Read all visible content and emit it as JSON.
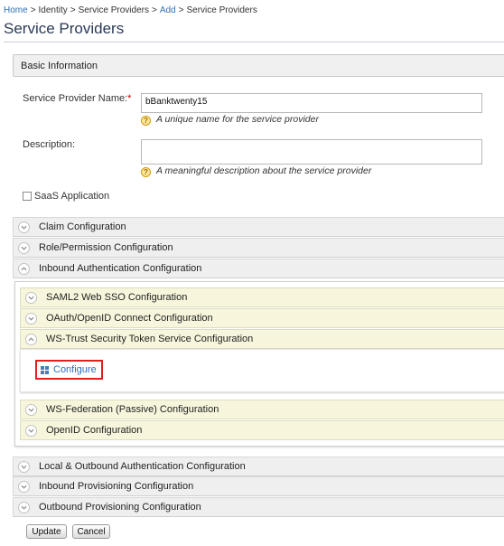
{
  "breadcrumb": {
    "home": "Home",
    "identity": "Identity",
    "service_providers": "Service Providers",
    "add": "Add",
    "current": "Service Providers",
    "separator": ">"
  },
  "page_title": "Service Providers",
  "basic_info": {
    "header": "Basic Information",
    "name_label": "Service Provider Name:",
    "required_mark": "*",
    "name_value": "bBanktwenty15",
    "name_hint": "A unique name for the service provider",
    "description_label": "Description:",
    "description_value": "",
    "description_hint": "A meaningful description about the service provider",
    "saas_label": "SaaS Application",
    "saas_checked": false
  },
  "sections": {
    "claim": "Claim Configuration",
    "role": "Role/Permission Configuration",
    "inbound_auth": "Inbound Authentication Configuration",
    "local_outbound": "Local & Outbound Authentication Configuration",
    "inbound_prov": "Inbound Provisioning Configuration",
    "outbound_prov": "Outbound Provisioning Configuration"
  },
  "inbound_auth_sections": {
    "saml2": "SAML2 Web SSO Configuration",
    "oauth": "OAuth/OpenID Connect Configuration",
    "ws_trust": "WS-Trust Security Token Service Configuration",
    "ws_fed": "WS-Federation (Passive) Configuration",
    "openid": "OpenID Configuration"
  },
  "ws_trust_panel": {
    "configure_label": "Configure"
  },
  "buttons": {
    "update": "Update",
    "cancel": "Cancel"
  },
  "icons": {
    "expand": "chevron-down-icon",
    "collapse": "chevron-up-icon",
    "help": "help-icon",
    "configure": "grid-icon"
  },
  "colors": {
    "link": "#2f6fb3",
    "highlight_border": "#e01f1f",
    "nested_header_bg": "#f7f6dc",
    "section_header_bg": "#efefef"
  }
}
